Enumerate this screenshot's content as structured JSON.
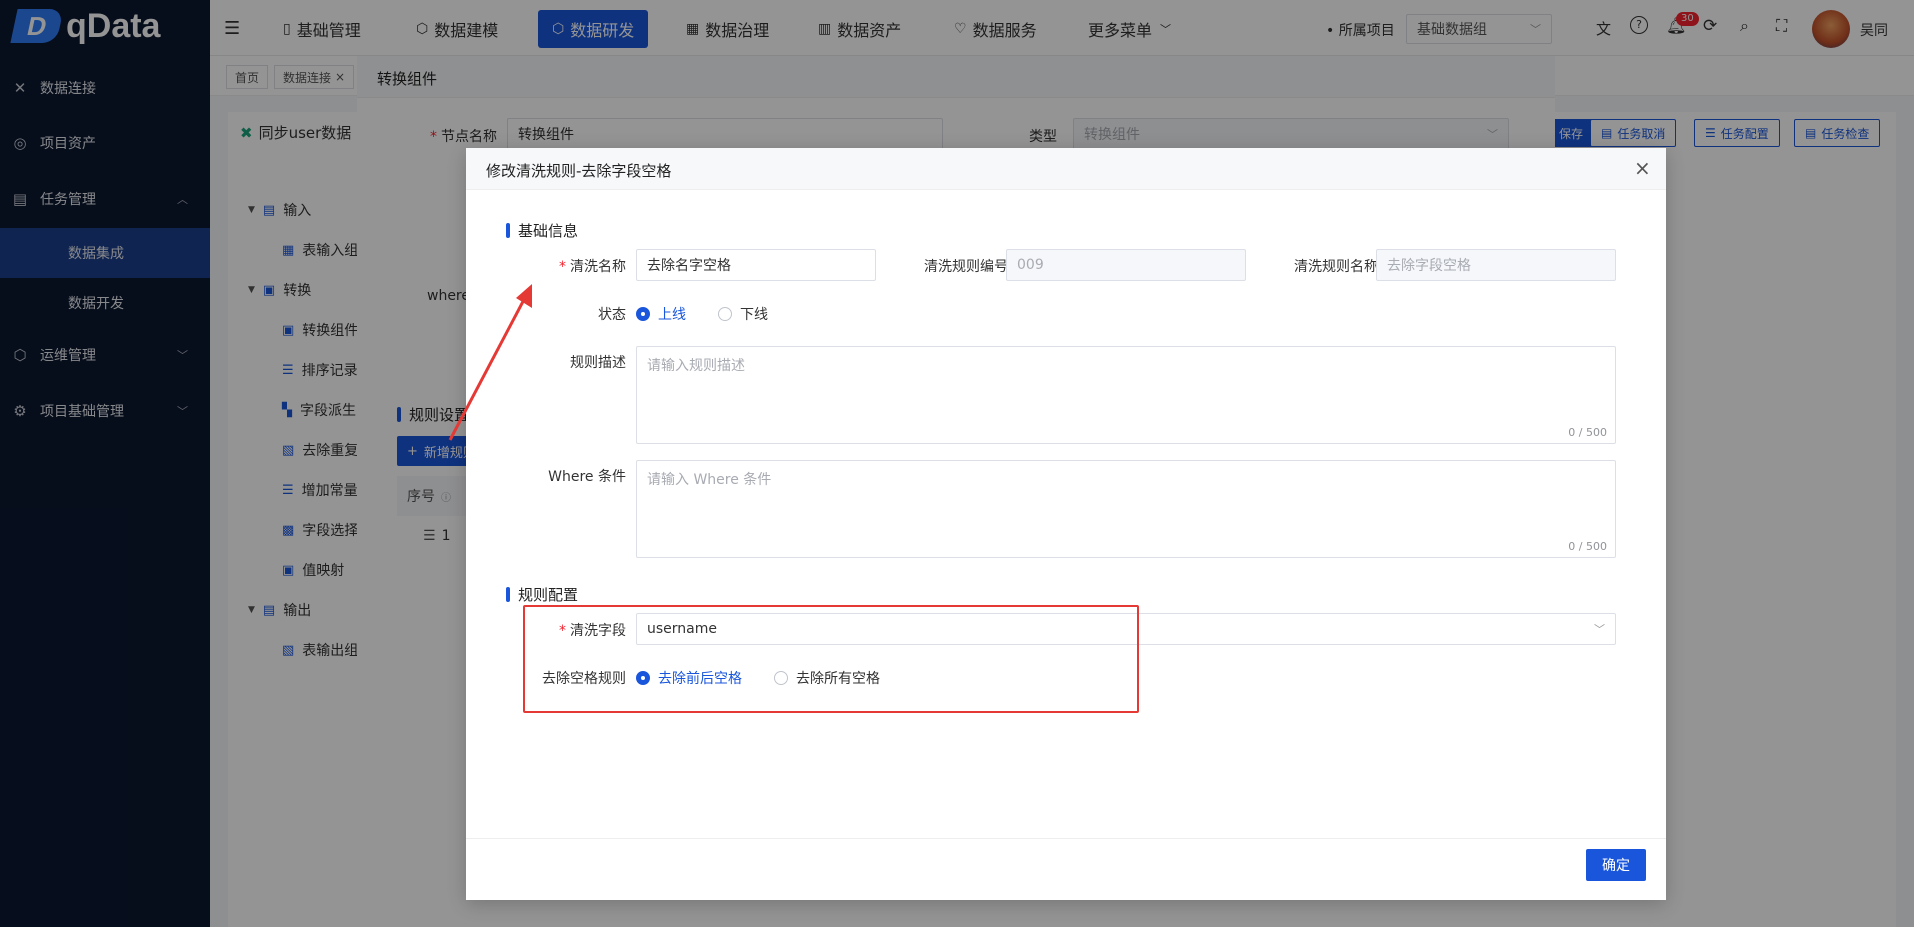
{
  "app": {
    "logo": "qData",
    "brand_color": "#1a56db",
    "sidebar_bg": "#0b1730"
  },
  "sidebar": {
    "items": [
      {
        "label": "数据连接",
        "icon": "link-icon"
      },
      {
        "label": "项目资产",
        "icon": "asset-icon"
      },
      {
        "label": "任务管理",
        "icon": "task-icon"
      },
      {
        "label": "数据集成",
        "icon": ""
      },
      {
        "label": "数据开发",
        "icon": ""
      },
      {
        "label": "运维管理",
        "icon": "ops-icon"
      },
      {
        "label": "项目基础管理",
        "icon": "gear-icon"
      }
    ]
  },
  "topnav": {
    "items": [
      "基础管理",
      "数据建模",
      "数据研发",
      "数据治理",
      "数据资产",
      "数据服务",
      "更多菜单"
    ],
    "project_label": "所属项目",
    "project_value": "基础数据组",
    "badge_count": "30",
    "user_name": "吴同"
  },
  "tabs": {
    "items": [
      "首页",
      "数据连接"
    ]
  },
  "background": {
    "page_title": "同步user数据",
    "buttons": [
      "保存",
      "任务取消",
      "任务配置",
      "任务检查"
    ],
    "tree": [
      {
        "label": "输入",
        "level": 0
      },
      {
        "label": "表输入组件",
        "level": 1
      },
      {
        "label": "转换",
        "level": 0
      },
      {
        "label": "转换组件",
        "level": 1
      },
      {
        "label": "排序记录",
        "level": 1
      },
      {
        "label": "字段派生",
        "level": 1
      },
      {
        "label": "去除重复",
        "level": 1
      },
      {
        "label": "增加常量",
        "level": 1
      },
      {
        "label": "字段选择",
        "level": 1
      },
      {
        "label": "值映射",
        "level": 1
      },
      {
        "label": "输出",
        "level": 0
      },
      {
        "label": "表输出组件",
        "level": 1
      }
    ]
  },
  "dialog1": {
    "title": "转换组件",
    "node_name_label": "节点名称",
    "node_name_value": "转换组件",
    "type_label": "类型",
    "type_value": "转换组件",
    "where_label": "where",
    "rules_section": "规则设置",
    "add_rule_button": "新增规则",
    "table_header_index": "序号",
    "table_row_index": "1"
  },
  "dialog2": {
    "title": "修改清洗规则-去除字段空格",
    "section_basic": "基础信息",
    "clean_name_label": "清洗名称",
    "clean_name_value": "去除名字空格",
    "rule_code_label": "清洗规则编号",
    "rule_code_value": "009",
    "rule_name_label": "清洗规则名称",
    "rule_name_value": "去除字段空格",
    "status_label": "状态",
    "status_online": "上线",
    "status_offline": "下线",
    "desc_label": "规则描述",
    "desc_placeholder": "请输入规则描述",
    "desc_count": "0 / 500",
    "where_label": "Where 条件",
    "where_placeholder": "请输入 Where 条件",
    "where_count": "0 / 500",
    "section_config": "规则配置",
    "field_label": "清洗字段",
    "field_value": "username",
    "trim_label": "去除空格规则",
    "trim_option1": "去除前后空格",
    "trim_option2": "去除所有空格",
    "confirm_button": "确定"
  },
  "annotation": {
    "box_color": "#e53935"
  }
}
